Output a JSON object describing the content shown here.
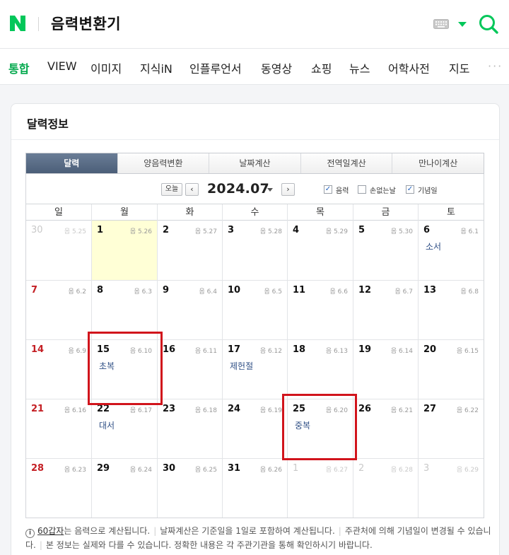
{
  "header": {
    "search_query": "음력변환기",
    "brand_color": "#03c75a"
  },
  "nav": {
    "tabs": [
      {
        "label": "통합",
        "active": true
      },
      {
        "label": "VIEW"
      },
      {
        "label": "이미지"
      },
      {
        "label": "지식iN"
      },
      {
        "label": "인플루언서"
      },
      {
        "label": "동영상"
      },
      {
        "label": "쇼핑"
      },
      {
        "label": "뉴스"
      },
      {
        "label": "어학사전"
      },
      {
        "label": "지도"
      }
    ],
    "more": "···"
  },
  "card": {
    "title": "달력정보",
    "tabs": [
      {
        "label": "달력",
        "active": true
      },
      {
        "label": "양음력변환"
      },
      {
        "label": "날짜계산"
      },
      {
        "label": "전역일계산"
      },
      {
        "label": "만나이계산"
      }
    ]
  },
  "calendar": {
    "today_label": "오늘",
    "prev": "‹",
    "next": "›",
    "current_month": "2024.07",
    "checkboxes": [
      {
        "label": "음력",
        "checked": true
      },
      {
        "label": "손없는날",
        "checked": false
      },
      {
        "label": "기념일",
        "checked": true
      }
    ],
    "weekdays": [
      "일",
      "월",
      "화",
      "수",
      "목",
      "금",
      "토"
    ],
    "weeks": [
      [
        {
          "day": "30",
          "lunar": "음 5.25",
          "other": true
        },
        {
          "day": "1",
          "lunar": "음 5.26",
          "highlight": true
        },
        {
          "day": "2",
          "lunar": "음 5.27"
        },
        {
          "day": "3",
          "lunar": "음 5.28"
        },
        {
          "day": "4",
          "lunar": "음 5.29"
        },
        {
          "day": "5",
          "lunar": "음 5.30"
        },
        {
          "day": "6",
          "lunar": "음 6.1",
          "holiday": "소서"
        }
      ],
      [
        {
          "day": "7",
          "lunar": "음 6.2"
        },
        {
          "day": "8",
          "lunar": "음 6.3"
        },
        {
          "day": "9",
          "lunar": "음 6.4"
        },
        {
          "day": "10",
          "lunar": "음 6.5"
        },
        {
          "day": "11",
          "lunar": "음 6.6"
        },
        {
          "day": "12",
          "lunar": "음 6.7"
        },
        {
          "day": "13",
          "lunar": "음 6.8"
        }
      ],
      [
        {
          "day": "14",
          "lunar": "음 6.9"
        },
        {
          "day": "15",
          "lunar": "음 6.10",
          "holiday": "초복"
        },
        {
          "day": "16",
          "lunar": "음 6.11"
        },
        {
          "day": "17",
          "lunar": "음 6.12",
          "holiday": "제헌절"
        },
        {
          "day": "18",
          "lunar": "음 6.13"
        },
        {
          "day": "19",
          "lunar": "음 6.14"
        },
        {
          "day": "20",
          "lunar": "음 6.15"
        }
      ],
      [
        {
          "day": "21",
          "lunar": "음 6.16"
        },
        {
          "day": "22",
          "lunar": "음 6.17",
          "holiday": "대서"
        },
        {
          "day": "23",
          "lunar": "음 6.18"
        },
        {
          "day": "24",
          "lunar": "음 6.19"
        },
        {
          "day": "25",
          "lunar": "음 6.20",
          "holiday": "중복"
        },
        {
          "day": "26",
          "lunar": "음 6.21"
        },
        {
          "day": "27",
          "lunar": "음 6.22"
        }
      ],
      [
        {
          "day": "28",
          "lunar": "음 6.23"
        },
        {
          "day": "29",
          "lunar": "음 6.24"
        },
        {
          "day": "30",
          "lunar": "음 6.25"
        },
        {
          "day": "31",
          "lunar": "음 6.26"
        },
        {
          "day": "1",
          "lunar": "음 6.27",
          "other": true
        },
        {
          "day": "2",
          "lunar": "음 6.28",
          "other": true
        },
        {
          "day": "3",
          "lunar": "음 6.29",
          "other": true
        }
      ]
    ]
  },
  "footer": {
    "info_icon": "i",
    "link": "60갑자",
    "text1": "는 음력으로 계산됩니다.",
    "text2": "날짜계산은 기준일을 1일로 포함하여 계산됩니다.",
    "text3": "주관처에 의해 기념일이 변경될 수 있습니다.",
    "text4": "본 정보는 실제와 다를 수 있습니다. 정확한 내용은 각 주관기관을 통해 확인하시기 바랍니다."
  }
}
